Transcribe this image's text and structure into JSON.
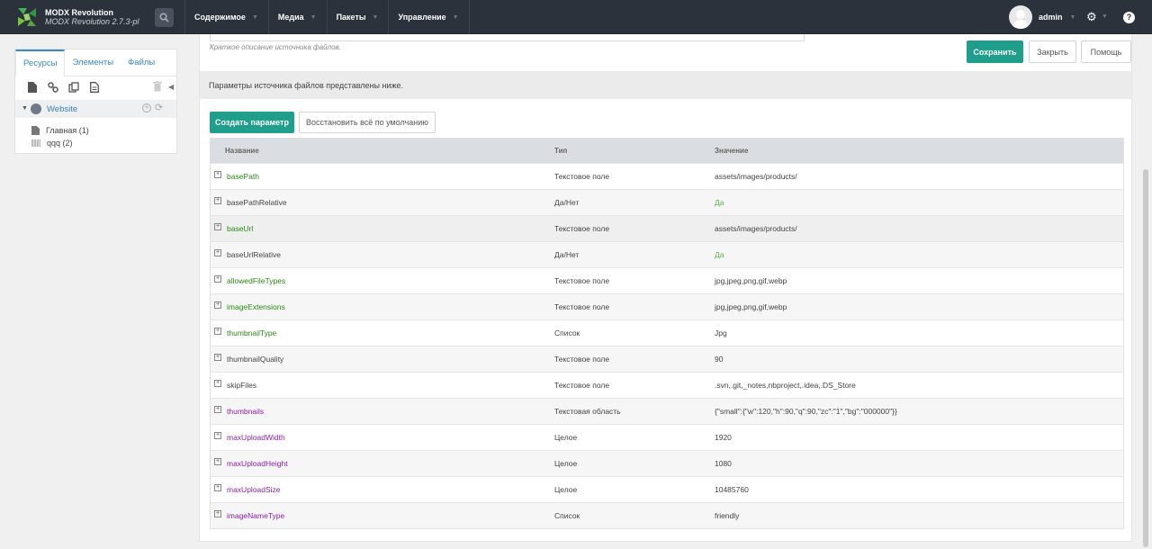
{
  "topbar": {
    "brand_title": "MODX Revolution",
    "brand_version": "MODX Revolution 2.7.3-pl",
    "menu": [
      "Содержимое",
      "Медиа",
      "Пакеты",
      "Управление"
    ],
    "username": "admin",
    "help": "?"
  },
  "sidebar": {
    "tabs": [
      "Ресурсы",
      "Элементы",
      "Файлы"
    ],
    "context_label": "Website",
    "items": [
      "Главная (1)",
      "qqq (2)"
    ]
  },
  "main": {
    "description_hint": "Краткое описание источника файлов.",
    "save_button": "Сохранить",
    "close_button": "Закрыть",
    "help_button": "Помощь",
    "params_info": "Параметры источника файлов представлены ниже.",
    "create_param_button": "Создать параметр",
    "restore_defaults_button": "Восстановить всё по умолчанию"
  },
  "grid": {
    "columns": [
      "Название",
      "Тип",
      "Значение"
    ],
    "rows": [
      {
        "name": "basePath",
        "type": "Текстовое поле",
        "value": "assets/images/products/",
        "name_color": "green"
      },
      {
        "name": "basePathRelative",
        "type": "Да/Нет",
        "value": "Да",
        "name_color": "black",
        "value_color": "green"
      },
      {
        "name": "baseUrl",
        "type": "Текстовое поле",
        "value": "assets/images/products/",
        "name_color": "green"
      },
      {
        "name": "baseUrlRelative",
        "type": "Да/Нет",
        "value": "Да",
        "name_color": "black",
        "value_color": "green"
      },
      {
        "name": "allowedFileTypes",
        "type": "Текстовое поле",
        "value": "jpg,jpeg,png,gif,webp",
        "name_color": "green"
      },
      {
        "name": "imageExtensions",
        "type": "Текстовое поле",
        "value": "jpg,jpeg,png,gif,webp",
        "name_color": "green"
      },
      {
        "name": "thumbnailType",
        "type": "Список",
        "value": "Jpg",
        "name_color": "green"
      },
      {
        "name": "thumbnailQuality",
        "type": "Текстовое поле",
        "value": "90",
        "name_color": "black"
      },
      {
        "name": "skipFiles",
        "type": "Текстовое поле",
        "value": ".svn,.git,_notes,nbproject,.idea,.DS_Store",
        "name_color": "black"
      },
      {
        "name": "thumbnails",
        "type": "Текстовая область",
        "value": "{\"small\":{\"w\":120,\"h\":90,\"q\":90,\"zc\":\"1\",\"bg\":\"000000\"}}",
        "name_color": "purple"
      },
      {
        "name": "maxUploadWidth",
        "type": "Целое",
        "value": "1920",
        "name_color": "purple"
      },
      {
        "name": "maxUploadHeight",
        "type": "Целое",
        "value": "1080",
        "name_color": "purple"
      },
      {
        "name": "maxUploadSize",
        "type": "Целое",
        "value": "10485760",
        "name_color": "purple"
      },
      {
        "name": "imageNameType",
        "type": "Список",
        "value": "friendly",
        "name_color": "purple"
      }
    ]
  },
  "colors": {
    "topbar": "#2b323c",
    "accent": "#1f9e8c",
    "link": "#3a8ac0"
  }
}
